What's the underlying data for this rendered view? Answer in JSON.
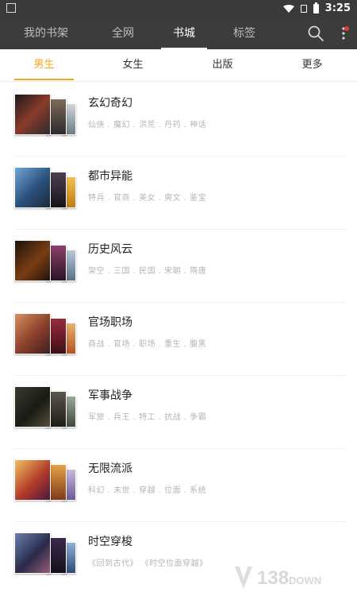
{
  "status_bar": {
    "time": "3:25"
  },
  "top_nav": {
    "tabs": [
      {
        "label": "我的书架"
      },
      {
        "label": "全网"
      },
      {
        "label": "书城"
      },
      {
        "label": "标签"
      }
    ],
    "active_tab": "书城"
  },
  "sub_tabs": {
    "tabs": [
      {
        "label": "男生"
      },
      {
        "label": "女生"
      },
      {
        "label": "出版"
      },
      {
        "label": "更多"
      }
    ],
    "active_tab": "男生",
    "accent_color": "#f5a623"
  },
  "categories": [
    {
      "title": "玄幻奇幻",
      "tags": "仙侠 . 魔幻 . 洪荒 . 丹药 . 神话"
    },
    {
      "title": "都市异能",
      "tags": "特兵 . 官商 . 美女 . 爽文 . 鉴宝"
    },
    {
      "title": "历史风云",
      "tags": "架空 . 三国 . 民国 . 宋朝 . 隋唐"
    },
    {
      "title": "官场职场",
      "tags": "商战 . 官场 . 职场 . 重生 . 腹黑"
    },
    {
      "title": "军事战争",
      "tags": "军旅 . 兵王 . 特工 . 抗战 . 争霸"
    },
    {
      "title": "无限流派",
      "tags": "科幻 . 末世 . 穿越 . 位面 . 系统"
    },
    {
      "title": "时空穿梭",
      "tags": "《回到古代》   《时空位面穿越》"
    }
  ],
  "watermark": {
    "text": "138",
    "suffix": "DOWN"
  }
}
